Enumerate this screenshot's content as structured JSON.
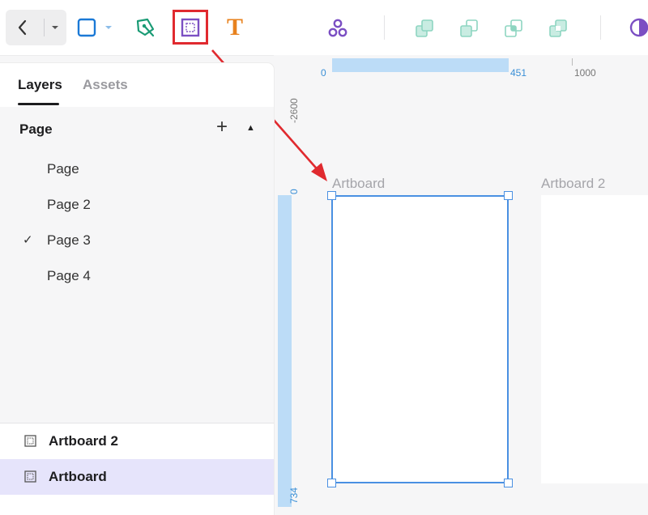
{
  "toolbar": {
    "icons": [
      "back-arrow-icon",
      "chevron-down-icon",
      "rectangle-tool-icon",
      "pen-tool-icon",
      "artboard-tool-icon",
      "text-tool-icon",
      "components-icon",
      "boolean-union-icon",
      "boolean-subtract-icon",
      "boolean-intersect-icon",
      "boolean-exclude-icon",
      "theme-toggle-icon"
    ],
    "text_tool_glyph": "T",
    "colors": {
      "blue": "#1b79d6",
      "green": "#1a9b75",
      "purple": "#7b4fc3",
      "orange": "#e8821e",
      "teal": "#8ed5c1",
      "highlight": "#e02a2f"
    }
  },
  "panel": {
    "tabs": [
      {
        "label": "Layers"
      },
      {
        "label": "Assets"
      }
    ],
    "pages_title": "Page",
    "add_glyph": "+",
    "collapse_glyph": "▲",
    "check_glyph": "✓",
    "pages": [
      {
        "label": "Page"
      },
      {
        "label": "Page 2"
      },
      {
        "label": "Page 3",
        "current": true
      },
      {
        "label": "Page 4"
      }
    ],
    "layers": [
      {
        "label": "Artboard 2"
      },
      {
        "label": "Artboard",
        "selected": true
      }
    ]
  },
  "canvas": {
    "ruler_top": {
      "start": "0",
      "end": "451",
      "mark": "1000"
    },
    "ruler_left": {
      "top_value": "-2600",
      "start": "0",
      "end": "734"
    },
    "artboards": [
      {
        "label": "Artboard"
      },
      {
        "label": "Artboard 2"
      }
    ]
  }
}
